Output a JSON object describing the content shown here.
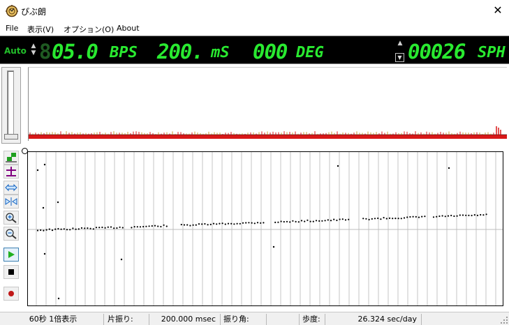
{
  "window": {
    "title": "ぴぶ朗",
    "close_glyph": "✕"
  },
  "menu": {
    "items": [
      "File",
      "表示(V)",
      "オプション(O)",
      "About"
    ]
  },
  "lcd": {
    "mode": "Auto",
    "bps_value": "05.0",
    "bps_unit": "BPS",
    "ms_value": "200.",
    "ms_unit": "mS",
    "deg_value": "000",
    "deg_unit": "DEG",
    "sph_value": "00026",
    "sph_unit": "SPH"
  },
  "colors": {
    "lcd_green": "#29ea30",
    "wave_red": "#d81818",
    "highlight": "#3c7fb1"
  },
  "toolbar": {
    "icons": [
      "snap-icon",
      "crosshair-icon",
      "expand-horizontal-icon",
      "shrink-horizontal-icon",
      "zoom-in-icon",
      "zoom-out-icon",
      "play-icon",
      "stop-icon",
      "record-icon"
    ]
  },
  "status": {
    "scale": "60秒 1倍表示",
    "beat_label": "片振り:",
    "beat_value": "200.000 msec",
    "angle_label": "振り角:",
    "angle_value": "",
    "rate_label": "歩度:",
    "rate_value": "26.324 sec/day"
  }
}
